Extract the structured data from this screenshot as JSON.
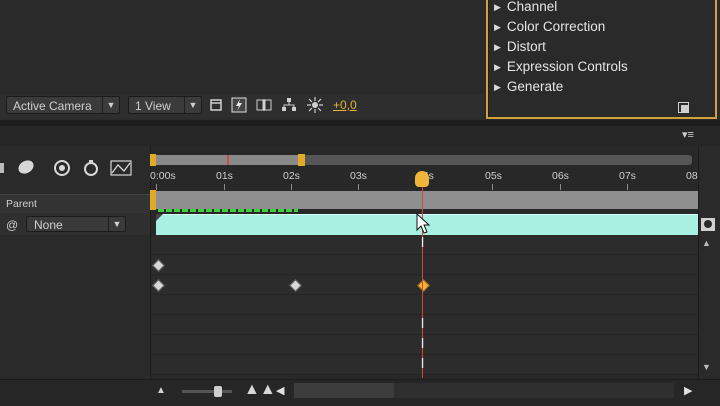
{
  "composition_viewer": {
    "camera_view": "Active Camera",
    "view_layout": "1 View",
    "exposure_value": "+0,0"
  },
  "effects_presets": {
    "categories": [
      "Channel",
      "Color Correction",
      "Distort",
      "Expression Controls",
      "Generate"
    ]
  },
  "timeline": {
    "parent_header": "Parent",
    "parent_value": "None",
    "ruler_ticks": [
      "0:00s",
      "01s",
      "02s",
      "03s",
      "04s",
      "05s",
      "06s",
      "07s",
      "08"
    ],
    "layer_bar_color": "#a7f0e2",
    "accent_color": "#e0a92a",
    "playhead_color": "#e0403a"
  },
  "icons": {
    "dropdown_arrow": "▼",
    "disclosure": "▶",
    "panel_menu": "▾≡",
    "parent_spiral": "@",
    "zoom_out": "▲",
    "zoom_in": "▲▲",
    "scroll_left": "◀",
    "scroll_right": "▶",
    "ibeam": "I"
  }
}
